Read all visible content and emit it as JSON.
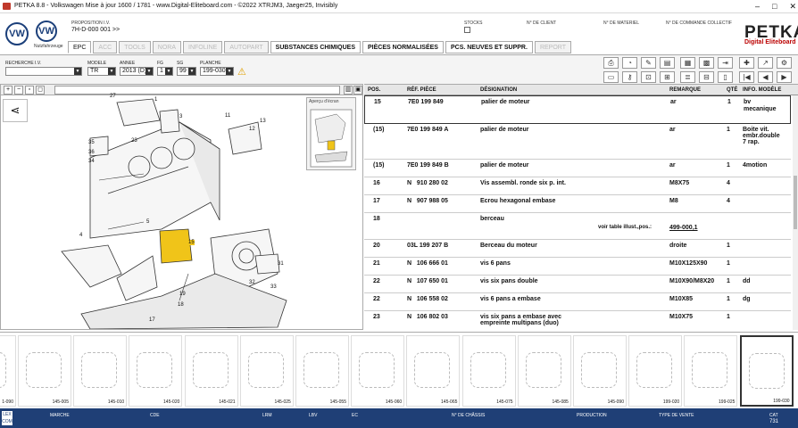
{
  "titlebar": {
    "text": "PETKA 8.8 - Volkswagen Mise à jour 1600 / 1781 - www.Digital-Eliteboard.com - ©2022 XTRJM3, Jaeger25, Invisibly"
  },
  "header": {
    "brand_sub": "Nutzfahrzeuge",
    "proposition_label": "PROPOSITION I.V.",
    "proposition_value": "7H-D-000 001 >>",
    "stocks_label": "STOCKS",
    "client_label": "N° DE CLIENT",
    "material_label": "N° DE MATERIEL",
    "order_label": "N° DE COMMANDE COLLECTIF",
    "petka": "PETKA",
    "petka_sub": "Digital Eliteboard"
  },
  "tabs": [
    {
      "label": "EPC",
      "state": "active"
    },
    {
      "label": "ACC",
      "state": "disabled"
    },
    {
      "label": "TOOLS",
      "state": "disabled"
    },
    {
      "label": "NORA",
      "state": "disabled"
    },
    {
      "label": "INFOLINE",
      "state": "disabled"
    },
    {
      "label": "AUTOPART",
      "state": "disabled"
    },
    {
      "label": "SUBSTANCES CHIMIQUES",
      "state": "on"
    },
    {
      "label": "PIÈCES NORMALISÉES",
      "state": "on"
    },
    {
      "label": "PCS. NEUVES ET SUPPR.",
      "state": "on"
    },
    {
      "label": "REPORT",
      "state": "disabled"
    }
  ],
  "filters": {
    "search_label": "RECHERCHE I.V.",
    "model_label": "MODELE",
    "model_value": "TR",
    "year_label": "ANNEE",
    "year_value": "2013 (D)",
    "fg_label": "FG",
    "fg_value": "1",
    "sg_label": "SG",
    "sg_value": "99",
    "plate_label": "PLANCHE",
    "plate_value": "199-030"
  },
  "preview": {
    "label": "Aperçu d'écran"
  },
  "callouts": [
    "27",
    "1",
    "3",
    "35",
    "36",
    "34",
    "23",
    "11",
    "12",
    "13",
    "4",
    "5",
    "15",
    "31",
    "32",
    "33",
    "19",
    "18",
    "17"
  ],
  "table": {
    "headers": {
      "pos": "POS.",
      "ref": "RÉF. PIÈCE",
      "desig": "DÉSIGNATION",
      "remark": "REMARQUE",
      "qty": "QTÉ",
      "info": "INFO. MODÈLE"
    },
    "rows": [
      {
        "pos": "15",
        "ref": "7E0 199 849",
        "desig": "palier de moteur",
        "remark": "ar",
        "qty": "1",
        "info": "bv\nmecanique",
        "h": 32
      },
      {
        "pos": "(15)",
        "ref": "7E0 199 849 A",
        "desig": "palier de moteur",
        "remark": "ar",
        "qty": "1",
        "info": "Boite vit.\nembr.double\n7 rap.",
        "h": 40
      },
      {
        "pos": "(15)",
        "ref": "7E0 199 849 B",
        "desig": "palier de moteur",
        "remark": "ar",
        "qty": "1",
        "info": "4motion",
        "h": 20
      },
      {
        "pos": "16",
        "ref": "N   910 280 02",
        "desig": "Vis assembl. ronde six p. int.",
        "remark": "M8X75",
        "qty": "4",
        "info": "",
        "h": 20
      },
      {
        "pos": "17",
        "ref": "N   907 988 05",
        "desig": "Ecrou hexagonal embase",
        "remark": "M8",
        "qty": "4",
        "info": "",
        "h": 20
      },
      {
        "pos": "18",
        "ref": "",
        "desig": "berceau",
        "remark": "",
        "qty": "",
        "info": "",
        "h": 30,
        "note": "voir table illust.,pos.:",
        "link": "499-000,1"
      },
      {
        "pos": "20",
        "ref": "03L 199 207 B",
        "desig": "Berceau du moteur",
        "remark": "droite",
        "qty": "1",
        "info": "",
        "h": 20
      },
      {
        "pos": "21",
        "ref": "N   106 666 01",
        "desig": "vis 6 pans",
        "remark": "M10X125X90",
        "qty": "1",
        "info": "",
        "h": 20
      },
      {
        "pos": "22",
        "ref": "N   107 650 01",
        "desig": "vis six pans double",
        "remark": "M10X90/M8X20",
        "qty": "1",
        "info": "dd",
        "h": 20
      },
      {
        "pos": "22",
        "ref": "N   106 558 02",
        "desig": "vis 6 pans a embase",
        "remark": "M10X85",
        "qty": "1",
        "info": "dg",
        "h": 20
      },
      {
        "pos": "23",
        "ref": "N   106 802 03",
        "desig": "vis six pans a embase avec\nempreinte multipans (duo)",
        "remark": "M10X75",
        "qty": "1",
        "info": "",
        "h": 24
      }
    ]
  },
  "thumbnails": [
    "1-090",
    "145-005",
    "145-010",
    "145-020",
    "145-021",
    "145-025",
    "145-055",
    "145-060",
    "145-065",
    "145-075",
    "145-085",
    "145-090",
    "199-020",
    "199-025",
    "199-030"
  ],
  "statusbar": {
    "logo": "LEX COM",
    "labels": [
      "MARCHE",
      "CDE",
      "LRM",
      "LBV",
      "EC",
      "N° DE CHÂSSIS",
      "PRODUCTION",
      "TYPE DE VENTE",
      "CAT"
    ],
    "cat_value": "731"
  }
}
